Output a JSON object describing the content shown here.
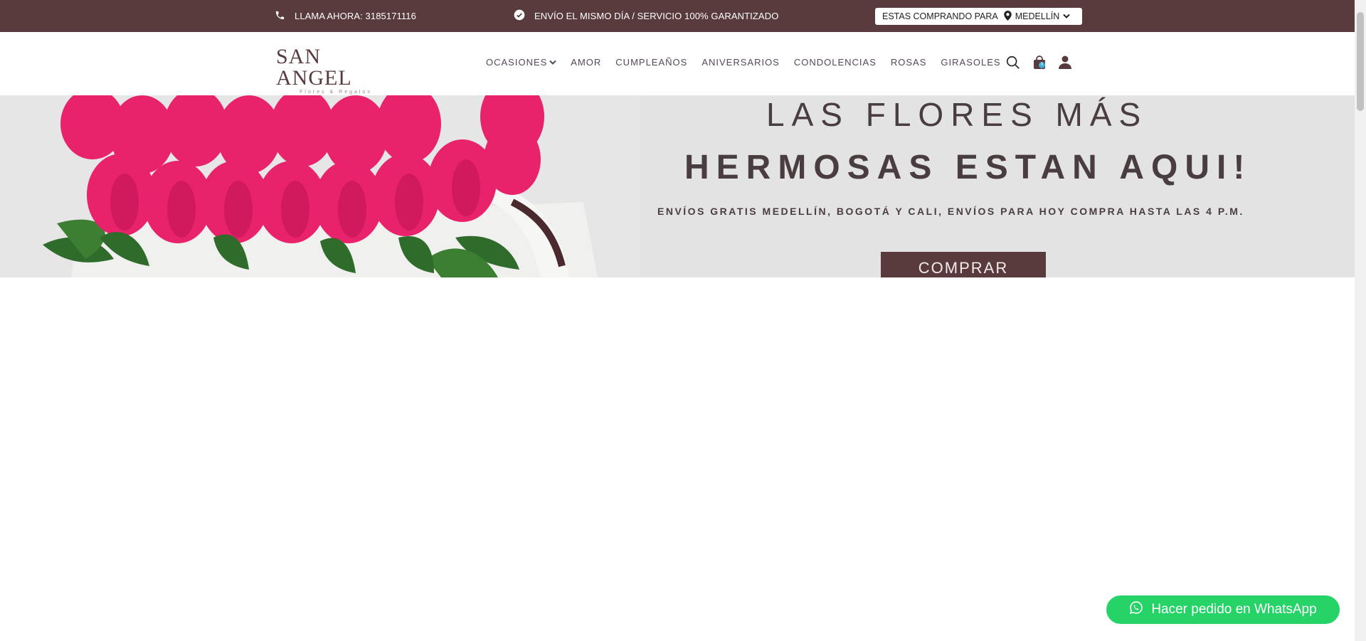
{
  "topbar": {
    "phone_text": "LLAMA AHORA: 3185171116",
    "shipping_text": "ENVÍO EL MISMO DÍA / SERVICIO 100% GARANTIZADO",
    "city_label": "ESTAS COMPRANDO PARA",
    "city_value": "MEDELLÍN",
    "background": "#5a3b3d"
  },
  "header": {
    "logo_name": "SAN ANGEL",
    "logo_sub": "Flores & Regalos",
    "nav": [
      "OCASIONES",
      "AMOR",
      "CUMPLEAÑOS",
      "ANIVERSARIOS",
      "CONDOLENCIAS",
      "ROSAS",
      "GIRASOLES"
    ],
    "cart_count": "0",
    "icons": [
      "search-icon",
      "shopping-bag-icon",
      "user-icon"
    ]
  },
  "banner": {
    "line1": "LAS FLORES MÁS",
    "line2": "HERMOSAS ESTAN AQUI!",
    "line3": "ENVÍOS GRATIS MEDELLÍN, BOGOTÁ Y CALI, ENVÍOS PARA HOY COMPRA HASTA LAS 4 P.M.",
    "button": "COMPRAR",
    "accent": "#5a3b3d",
    "rose_color": "#e8236c"
  },
  "whatsapp": {
    "label": "Hacer pedido en WhatsApp",
    "color": "#25d366"
  }
}
